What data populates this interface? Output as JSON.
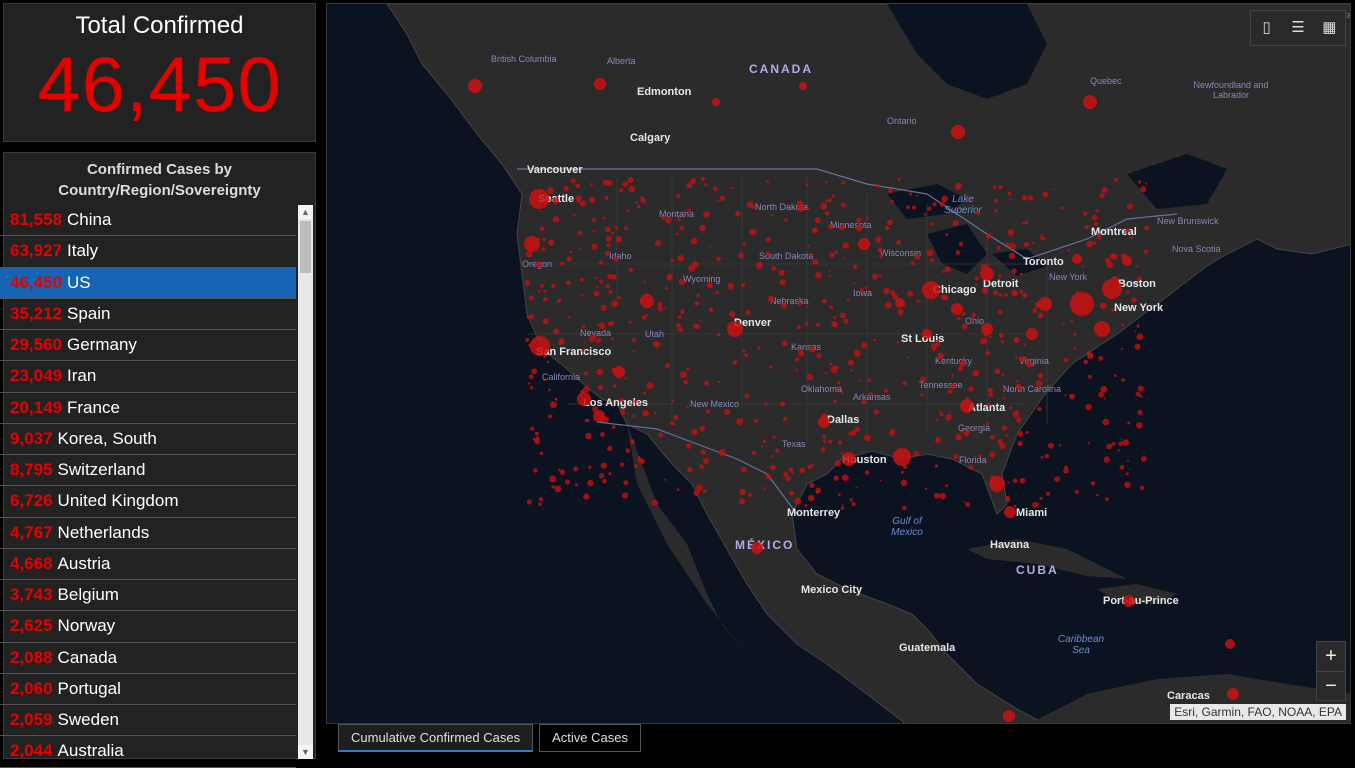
{
  "total": {
    "title": "Total Confirmed",
    "value": "46,450"
  },
  "list": {
    "header_line1": "Confirmed Cases by",
    "header_line2": "Country/Region/Sovereignty",
    "rows": [
      {
        "count": "81,558",
        "name": "China"
      },
      {
        "count": "63,927",
        "name": "Italy"
      },
      {
        "count": "46,450",
        "name": "US"
      },
      {
        "count": "35,212",
        "name": "Spain"
      },
      {
        "count": "29,560",
        "name": "Germany"
      },
      {
        "count": "23,049",
        "name": "Iran"
      },
      {
        "count": "20,149",
        "name": "France"
      },
      {
        "count": "9,037",
        "name": "Korea, South"
      },
      {
        "count": "8,795",
        "name": "Switzerland"
      },
      {
        "count": "6,726",
        "name": "United Kingdom"
      },
      {
        "count": "4,767",
        "name": "Netherlands"
      },
      {
        "count": "4,668",
        "name": "Austria"
      },
      {
        "count": "3,743",
        "name": "Belgium"
      },
      {
        "count": "2,625",
        "name": "Norway"
      },
      {
        "count": "2,088",
        "name": "Canada"
      },
      {
        "count": "2,060",
        "name": "Portugal"
      },
      {
        "count": "2,059",
        "name": "Sweden"
      },
      {
        "count": "2,044",
        "name": "Australia"
      }
    ]
  },
  "map": {
    "country_labels": [
      "CANADA",
      "MÉXICO",
      "CUBA"
    ],
    "region_labels": [
      "British Columbia",
      "Alberta",
      "Ontario",
      "Quebec",
      "Newfoundland and Labrador",
      "New Brunswick",
      "Nova Scotia",
      "Montana",
      "North Dakota",
      "Minnesota",
      "Idaho",
      "Oregon",
      "Wyoming",
      "South Dakota",
      "Wisconsin",
      "Nebraska",
      "Iowa",
      "Nevada",
      "Utah",
      "California",
      "Kansas",
      "Ohio",
      "Kentucky",
      "Virginia",
      "Oklahoma",
      "Arkansas",
      "Tennessee",
      "North Carolina",
      "New Mexico",
      "Texas",
      "Georgia",
      "Florida",
      "New York",
      "Labrador"
    ],
    "city_labels": [
      "Edmonton",
      "Calgary",
      "Vancouver",
      "Seattle",
      "Montreal",
      "Toronto",
      "Detroit",
      "Chicago",
      "Boston",
      "New York",
      "Denver",
      "St Louis",
      "San Francisco",
      "Los Angeles",
      "Atlanta",
      "Dallas",
      "Houston",
      "Miami",
      "Monterrey",
      "Havana",
      "Mexico City",
      "Port-au-Prince",
      "Guatemala",
      "Caracas"
    ],
    "water_labels": [
      "Lake Superior",
      "Gulf of Mexico",
      "Caribbean Sea"
    ],
    "attribution": "Esri, Garmin, FAO, NOAA, EPA",
    "zoom_in": "+",
    "zoom_out": "−"
  },
  "tabs": [
    {
      "label": "Cumulative Confirmed Cases",
      "active": true
    },
    {
      "label": "Active Cases",
      "active": false
    }
  ],
  "colors": {
    "accent_red": "#e60000",
    "selected_row": "#1565b4",
    "panel_bg": "#222222",
    "water": "#0b1220",
    "land": "#2b2b2b"
  },
  "icons": [
    "bookmark-icon",
    "legend-list-icon",
    "basemap-gallery-icon",
    "scroll-up-icon",
    "scroll-down-icon"
  ]
}
